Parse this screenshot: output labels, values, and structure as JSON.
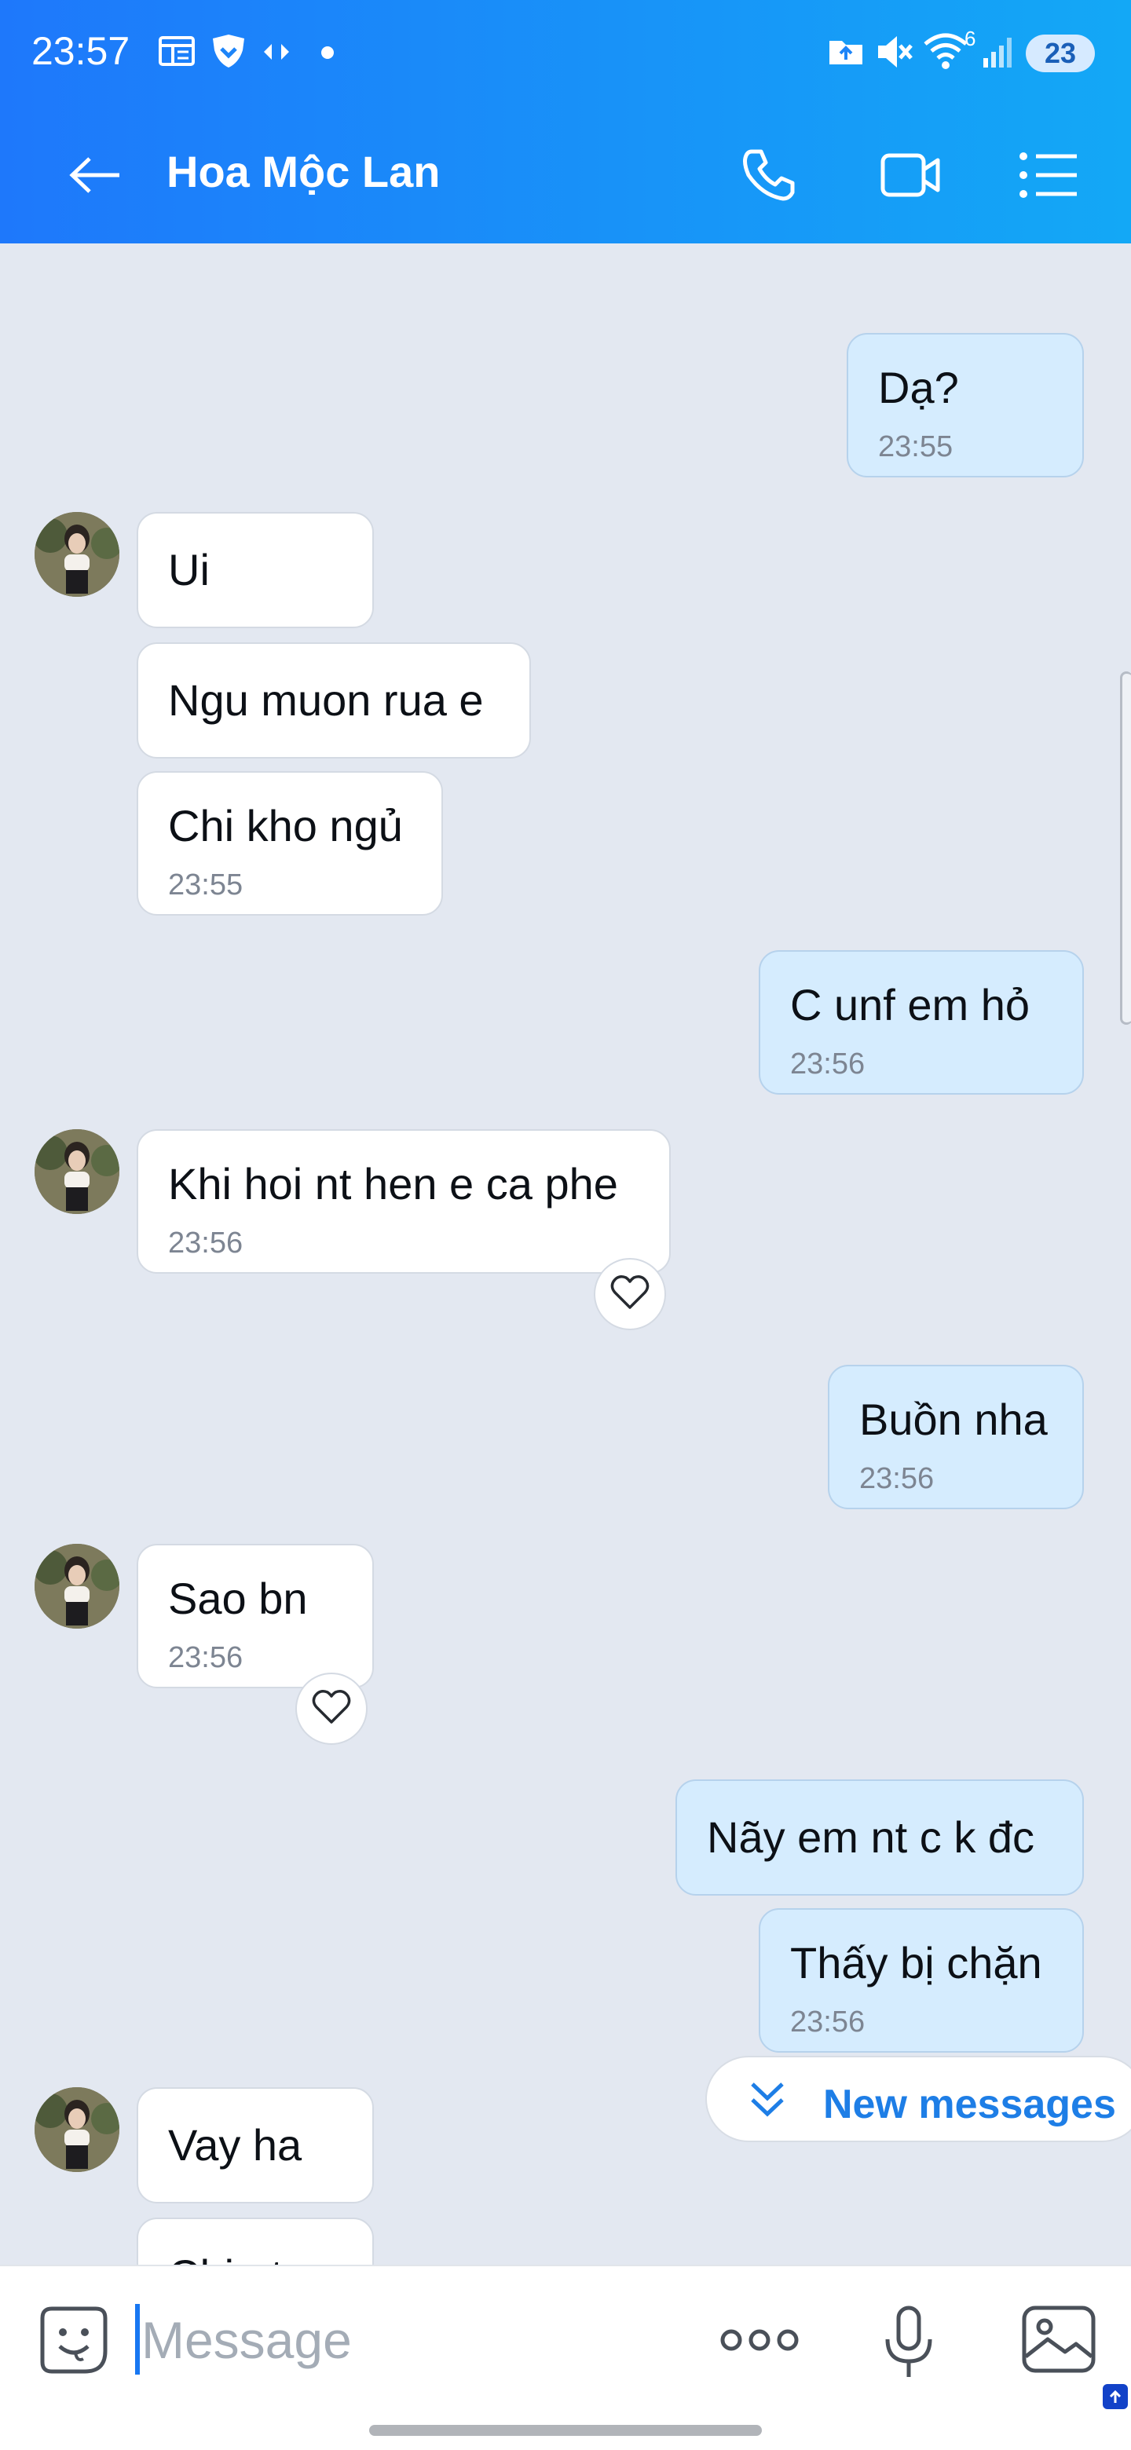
{
  "status_bar": {
    "time": "23:57",
    "network_type": "6",
    "battery": "23",
    "icons": [
      "news-icon",
      "shield-icon",
      "sync-arrows-icon",
      "dot-icon",
      "upload-folder-icon",
      "mute-icon",
      "wifi-icon",
      "signal-icon"
    ]
  },
  "header": {
    "contact_name": "Hoa Mộc Lan",
    "actions": [
      "back-icon",
      "phone-icon",
      "video-call-icon",
      "menu-icon"
    ]
  },
  "messages": [
    {
      "side": "out",
      "lines": [
        "Dạ?"
      ],
      "time": "23:55"
    },
    {
      "side": "in",
      "lines": [
        "Ui"
      ],
      "time": ""
    },
    {
      "side": "in",
      "lines": [
        "Ngu muon rua e"
      ],
      "time": ""
    },
    {
      "side": "in",
      "lines": [
        "Chi kho ngủ"
      ],
      "time": "23:55"
    },
    {
      "side": "out",
      "lines": [
        "C unf em hỏ"
      ],
      "time": "23:56"
    },
    {
      "side": "in",
      "lines": [
        "Khi hoi nt hen e ca phe"
      ],
      "time": "23:56"
    },
    {
      "side": "out",
      "lines": [
        "Buồn nha"
      ],
      "time": "23:56"
    },
    {
      "side": "in",
      "lines": [
        "Sao bn"
      ],
      "time": "23:56"
    },
    {
      "side": "out",
      "lines": [
        "Nãy em nt c k đc"
      ],
      "time": ""
    },
    {
      "side": "out",
      "lines": [
        "Thấy bị chặn"
      ],
      "time": "23:56"
    },
    {
      "side": "in",
      "lines": [
        "Vay ha"
      ],
      "time": ""
    },
    {
      "side": "in",
      "lines": [
        "Chi nt"
      ],
      "time": ""
    }
  ],
  "new_messages_label": "New messages",
  "input": {
    "placeholder": "Message",
    "icons": [
      "emoji-sticker-icon",
      "more-options-icon",
      "microphone-icon",
      "gallery-icon"
    ]
  }
}
